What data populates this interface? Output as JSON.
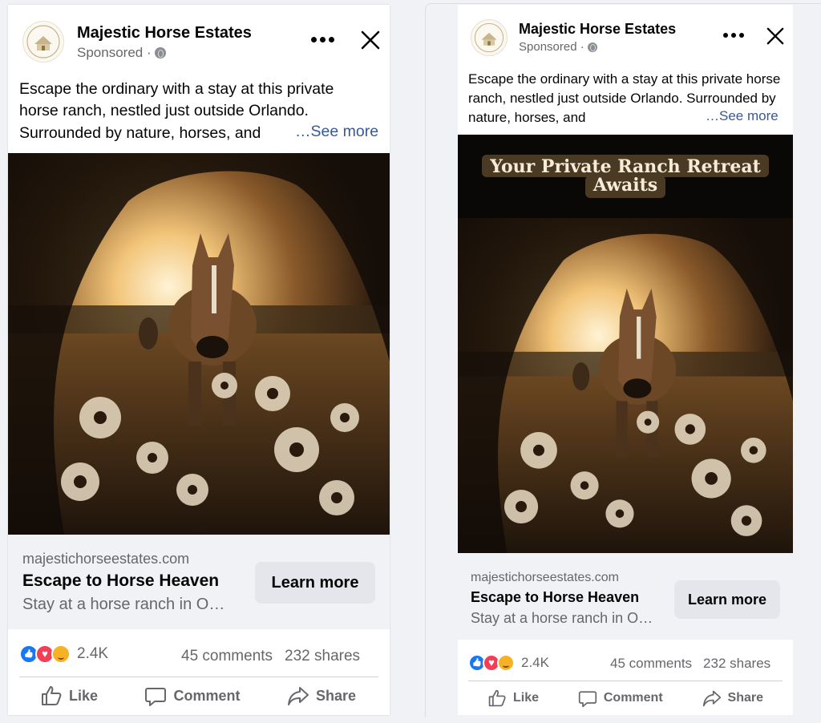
{
  "ad": {
    "page_name": "Majestic Horse Estates",
    "sponsored_label": "Sponsored ·",
    "body_text": "Escape the ordinary with a stay at this private horse ranch, nestled just outside Orlando. Surrounded by nature, horses, and",
    "see_more": "…See more",
    "link": {
      "domain": "majestichorseestates.com",
      "headline": "Escape to Horse Heaven",
      "description": "Stay at a horse ranch in O…",
      "cta": "Learn more"
    },
    "reactions": {
      "count": "2.4K",
      "comments": "45 comments",
      "shares": "232 shares"
    },
    "actions": {
      "like": "Like",
      "comment": "Comment",
      "share": "Share"
    }
  },
  "right_variant": {
    "banner_line1": "Your Private Ranch Retreat",
    "banner_line2": "Awaits"
  },
  "colors": {
    "link_blue": "#385898",
    "facebook_blue": "#1877f2",
    "muted_text": "#65676b"
  }
}
